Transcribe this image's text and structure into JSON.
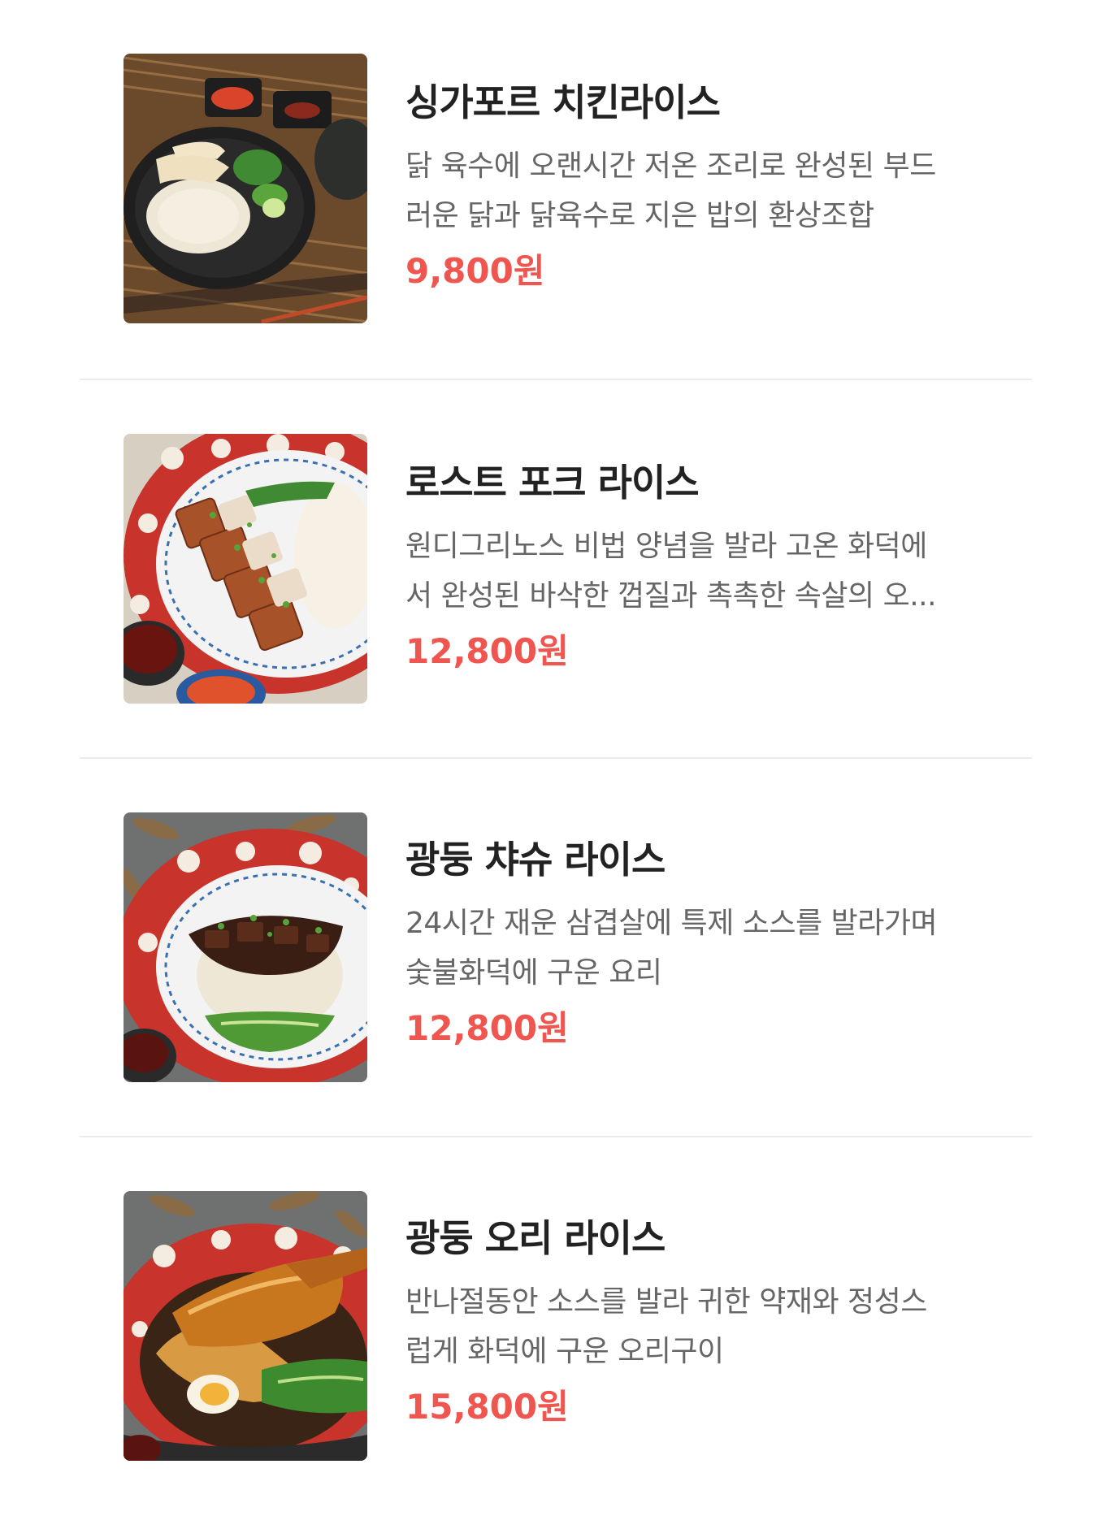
{
  "theme": {
    "price_color": "#f05650",
    "title_color": "#222222",
    "desc_color": "#666666",
    "divider_color": "#ebebeb"
  },
  "menu": {
    "items": [
      {
        "title": "싱가포르 치킨라이스",
        "desc_lines": [
          "닭 육수에 오랜시간 저온 조리로 완성된 부드",
          "러운 닭과 닭육수로 지은 밥의 환상조합"
        ],
        "price": "9,800원",
        "image_icon": "chicken-rice-photo"
      },
      {
        "title": "로스트 포크 라이스",
        "desc_lines": [
          "원디그리노스 비법 양념을 발라 고온 화덕에",
          "서 완성된 바삭한 껍질과 촉촉한 속살의 오..."
        ],
        "price": "12,800원",
        "image_icon": "roast-pork-rice-photo"
      },
      {
        "title": "광둥 챠슈 라이스",
        "desc_lines": [
          "24시간 재운 삼겹살에 특제 소스를 발라가며",
          "숯불화덕에 구운 요리"
        ],
        "price": "12,800원",
        "image_icon": "char-siu-rice-photo"
      },
      {
        "title": "광둥 오리 라이스",
        "desc_lines": [
          "반나절동안 소스를 발라 귀한 약재와 정성스",
          "럽게 화덕에 구운 오리구이"
        ],
        "price": "15,800원",
        "image_icon": "duck-rice-photo"
      }
    ]
  }
}
